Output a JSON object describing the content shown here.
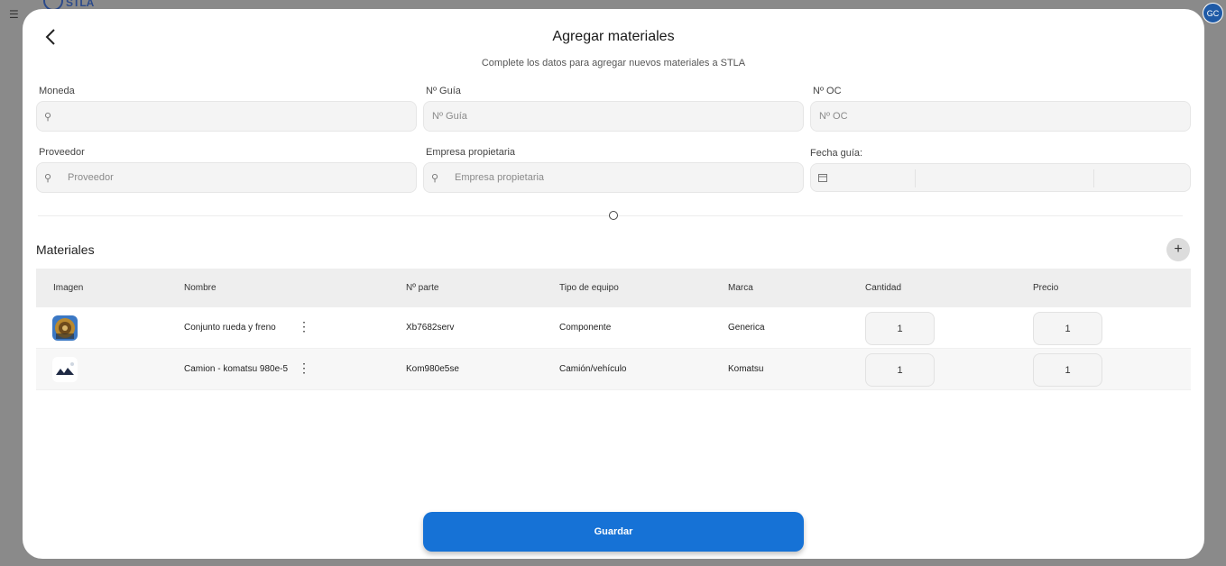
{
  "background": {
    "logo_text": "STLA",
    "avatar_initials": "GC"
  },
  "modal": {
    "title": "Agregar materiales",
    "subtitle": "Complete los datos para agregar nuevos materiales a STLA"
  },
  "form": {
    "moneda": {
      "label": "Moneda",
      "placeholder": ""
    },
    "guia": {
      "label": "Nº Guía",
      "placeholder": "Nº Guía"
    },
    "oc": {
      "label": "Nº OC",
      "placeholder": "Nº OC"
    },
    "proveedor": {
      "label": "Proveedor",
      "placeholder": "Proveedor"
    },
    "empresa": {
      "label": "Empresa propietaria",
      "placeholder": "Empresa propietaria"
    },
    "fecha": {
      "label": "Fecha guía:",
      "placeholder": ""
    }
  },
  "materials": {
    "title": "Materiales",
    "add_label": "+",
    "columns": [
      "Imagen",
      "Nombre",
      "Nº parte",
      "Tipo de equipo",
      "Marca",
      "Cantidad",
      "Precio"
    ],
    "rows": [
      {
        "nombre": "Conjunto rueda y freno",
        "parte": "Xb7682serv",
        "tipo": "Componente",
        "marca": "Generica",
        "cantidad": "1",
        "precio": "1",
        "image_icon": "wheel-brake-image"
      },
      {
        "nombre": "Camion - komatsu 980e-5",
        "parte": "Kom980e5se",
        "tipo": "Camión/vehículo",
        "marca": "Komatsu",
        "cantidad": "1",
        "precio": "1",
        "image_icon": "truck-image"
      }
    ]
  },
  "actions": {
    "save_label": "Guardar"
  },
  "colors": {
    "primary": "#1672d6",
    "overlay": "#8a8a8a"
  }
}
